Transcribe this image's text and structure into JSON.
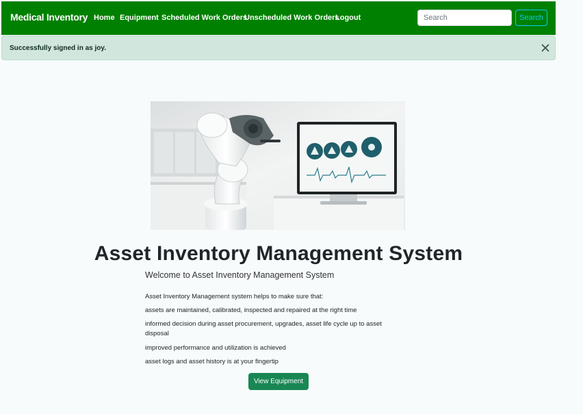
{
  "navbar": {
    "brand": "Medical Inventory",
    "links": [
      {
        "label": "Home"
      },
      {
        "label": "Equipment"
      },
      {
        "label": "Scheduled Work Orders"
      },
      {
        "label": "Unscheduled Work Orders"
      },
      {
        "label": "Logout"
      }
    ],
    "search_placeholder": "Search",
    "search_button": "Search"
  },
  "alert": {
    "message": "Successfully signed in as joy.",
    "close_icon": "close-icon"
  },
  "hero": {
    "image_icon": "robot-arm-monitor-image"
  },
  "main": {
    "title": "Asset Inventory Management System",
    "subtitle": "Welcome to Asset Inventory Management System",
    "lines": [
      "Asset Inventory Management system helps to make sure that:",
      "assets are maintained, calibrated, inspected and repaired at the right time",
      "informed decision during asset procurement, upgrades, asset life cycle up to asset disposal",
      "improved performance and utilization is achieved",
      "asset logs and asset history is at your fingertip"
    ],
    "cta_label": "View Equipment"
  },
  "colors": {
    "navbar": "#008000",
    "alert_bg": "#d1e7dd",
    "search_accent": "#0dcaf0",
    "cta": "#198754"
  }
}
